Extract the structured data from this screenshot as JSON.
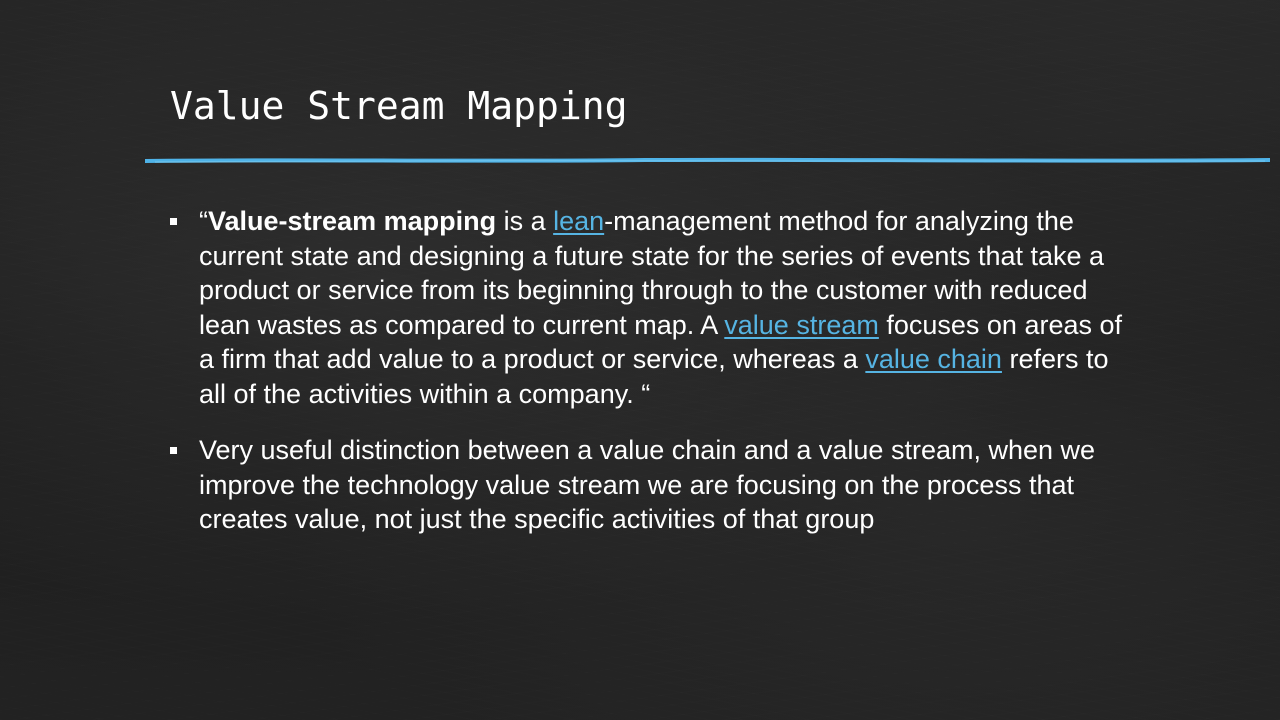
{
  "slide": {
    "title": "Value Stream Mapping",
    "accent_color": "#4fb3e8",
    "bullets": [
      {
        "open_quote": "“",
        "term": "Value-stream mapping",
        "text_1": " is a ",
        "link_lean": "lean",
        "text_2": "-management method for analyzing the current state and designing a future state for the series of events that take a product or service from its beginning through to the customer with reduced lean wastes as compared to current map. A ",
        "link_value_stream": "value stream",
        "text_3": " focuses on areas of a firm that add value to a product or service, whereas a ",
        "link_value_chain": "value chain",
        "text_4": " refers to all of the activities within a company. “"
      },
      {
        "text": "Very useful distinction between a value chain and a value stream, when we improve the technology value stream we are focusing on the process that creates value, not just the specific activities of that group"
      }
    ]
  }
}
